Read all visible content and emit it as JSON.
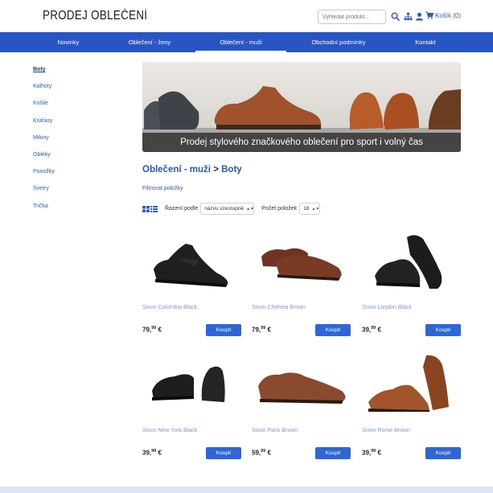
{
  "header": {
    "logo": "PRODEJ OBLEČENÍ",
    "search_placeholder": "Vyhledat produkt...",
    "cart_label": "Košík (0)"
  },
  "nav": {
    "items": [
      {
        "label": "Novinky"
      },
      {
        "label": "Oblečení - ženy"
      },
      {
        "label": "Oblečení - muži",
        "active": true
      },
      {
        "label": "Obchodní podmínky"
      },
      {
        "label": "Kontakt"
      }
    ]
  },
  "sidebar": {
    "items": [
      {
        "label": "Boty",
        "active": true
      },
      {
        "label": "Kalhoty"
      },
      {
        "label": "Košile"
      },
      {
        "label": "Kraťasy"
      },
      {
        "label": "Mikiny"
      },
      {
        "label": "Obleky"
      },
      {
        "label": "Ponožky"
      },
      {
        "label": "Svetry"
      },
      {
        "label": "Trička"
      }
    ]
  },
  "banner": {
    "caption": "Prodej stylového značkového oblečení pro sport i volný čas"
  },
  "breadcrumb": {
    "parent": "Oblečení - muži",
    "separator": ">",
    "current": "Boty"
  },
  "filter_link": "Filtrovat položky",
  "toolbar": {
    "sort_label": "Řazení podle",
    "sort_value": "názvu vzestupně",
    "count_label": "Počet položek",
    "count_value": "18"
  },
  "products": [
    {
      "name": "Sixon Columbia Black",
      "price_int": "79,",
      "price_dec": "99",
      "currency": "€",
      "buy": "Koupit",
      "color": "black"
    },
    {
      "name": "Sixon Chelsea Brown",
      "price_int": "79,",
      "price_dec": "99",
      "currency": "€",
      "buy": "Koupit",
      "color": "brown"
    },
    {
      "name": "Sixon London Black",
      "price_int": "39,",
      "price_dec": "99",
      "currency": "€",
      "buy": "Koupit",
      "color": "black"
    },
    {
      "name": "Sixon New York Black",
      "price_int": "39,",
      "price_dec": "99",
      "currency": "€",
      "buy": "Koupit",
      "color": "black"
    },
    {
      "name": "Sixon Paris Brown",
      "price_int": "59,",
      "price_dec": "99",
      "currency": "€",
      "buy": "Koupit",
      "color": "brown"
    },
    {
      "name": "Sixon Rome Brown",
      "price_int": "39,",
      "price_dec": "99",
      "currency": "€",
      "buy": "Koupit",
      "color": "brown"
    }
  ],
  "icons": {
    "search": "search-icon",
    "sitemap": "sitemap-icon",
    "user": "user-icon",
    "cart": "cart-icon",
    "grid_view": "grid-view-icon",
    "list_view": "list-view-icon"
  },
  "colors": {
    "nav_bg": "#2855c4",
    "link": "#2f5bbd",
    "buy_button": "#2e66d6"
  }
}
